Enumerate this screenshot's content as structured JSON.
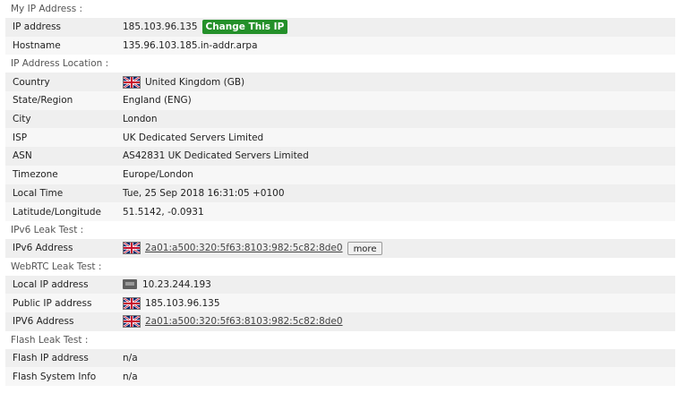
{
  "sections": {
    "my_ip": "My IP Address :",
    "location": "IP Address Location :",
    "ipv6": "IPv6 Leak Test :",
    "webrtc": "WebRTC Leak Test :",
    "flash": "Flash Leak Test :"
  },
  "my_ip": {
    "ip_label": "IP address",
    "ip_value": "185.103.96.135",
    "change_button": "Change This IP",
    "hostname_label": "Hostname",
    "hostname_value": "135.96.103.185.in-addr.arpa"
  },
  "location": {
    "country_label": "Country",
    "country_value": "United Kingdom (GB)",
    "state_label": "State/Region",
    "state_value": "England (ENG)",
    "city_label": "City",
    "city_value": "London",
    "isp_label": "ISP",
    "isp_value": "UK Dedicated Servers Limited",
    "asn_label": "ASN",
    "asn_value": "AS42831 UK Dedicated Servers Limited",
    "timezone_label": "Timezone",
    "timezone_value": "Europe/London",
    "localtime_label": "Local Time",
    "localtime_value": "Tue, 25 Sep 2018 16:31:05 +0100",
    "latlon_label": "Latitude/Longitude",
    "latlon_value": "51.5142, -0.0931"
  },
  "ipv6": {
    "label": "IPv6 Address",
    "value": "2a01:a500:320:5f63:8103:982:5c82:8de0",
    "more_button": "more"
  },
  "webrtc": {
    "local_label": "Local IP address",
    "local_value": "10.23.244.193",
    "public_label": "Public IP address",
    "public_value": "185.103.96.135",
    "ipv6_label": "IPV6 Address",
    "ipv6_value": "2a01:a500:320:5f63:8103:982:5c82:8de0"
  },
  "flash": {
    "ip_label": "Flash IP address",
    "ip_value": "n/a",
    "info_label": "Flash System Info",
    "info_value": "n/a"
  },
  "icons": {
    "uk_flag": "uk-flag-icon",
    "lan": "network-icon"
  },
  "colors": {
    "change_button": "#24902a"
  }
}
